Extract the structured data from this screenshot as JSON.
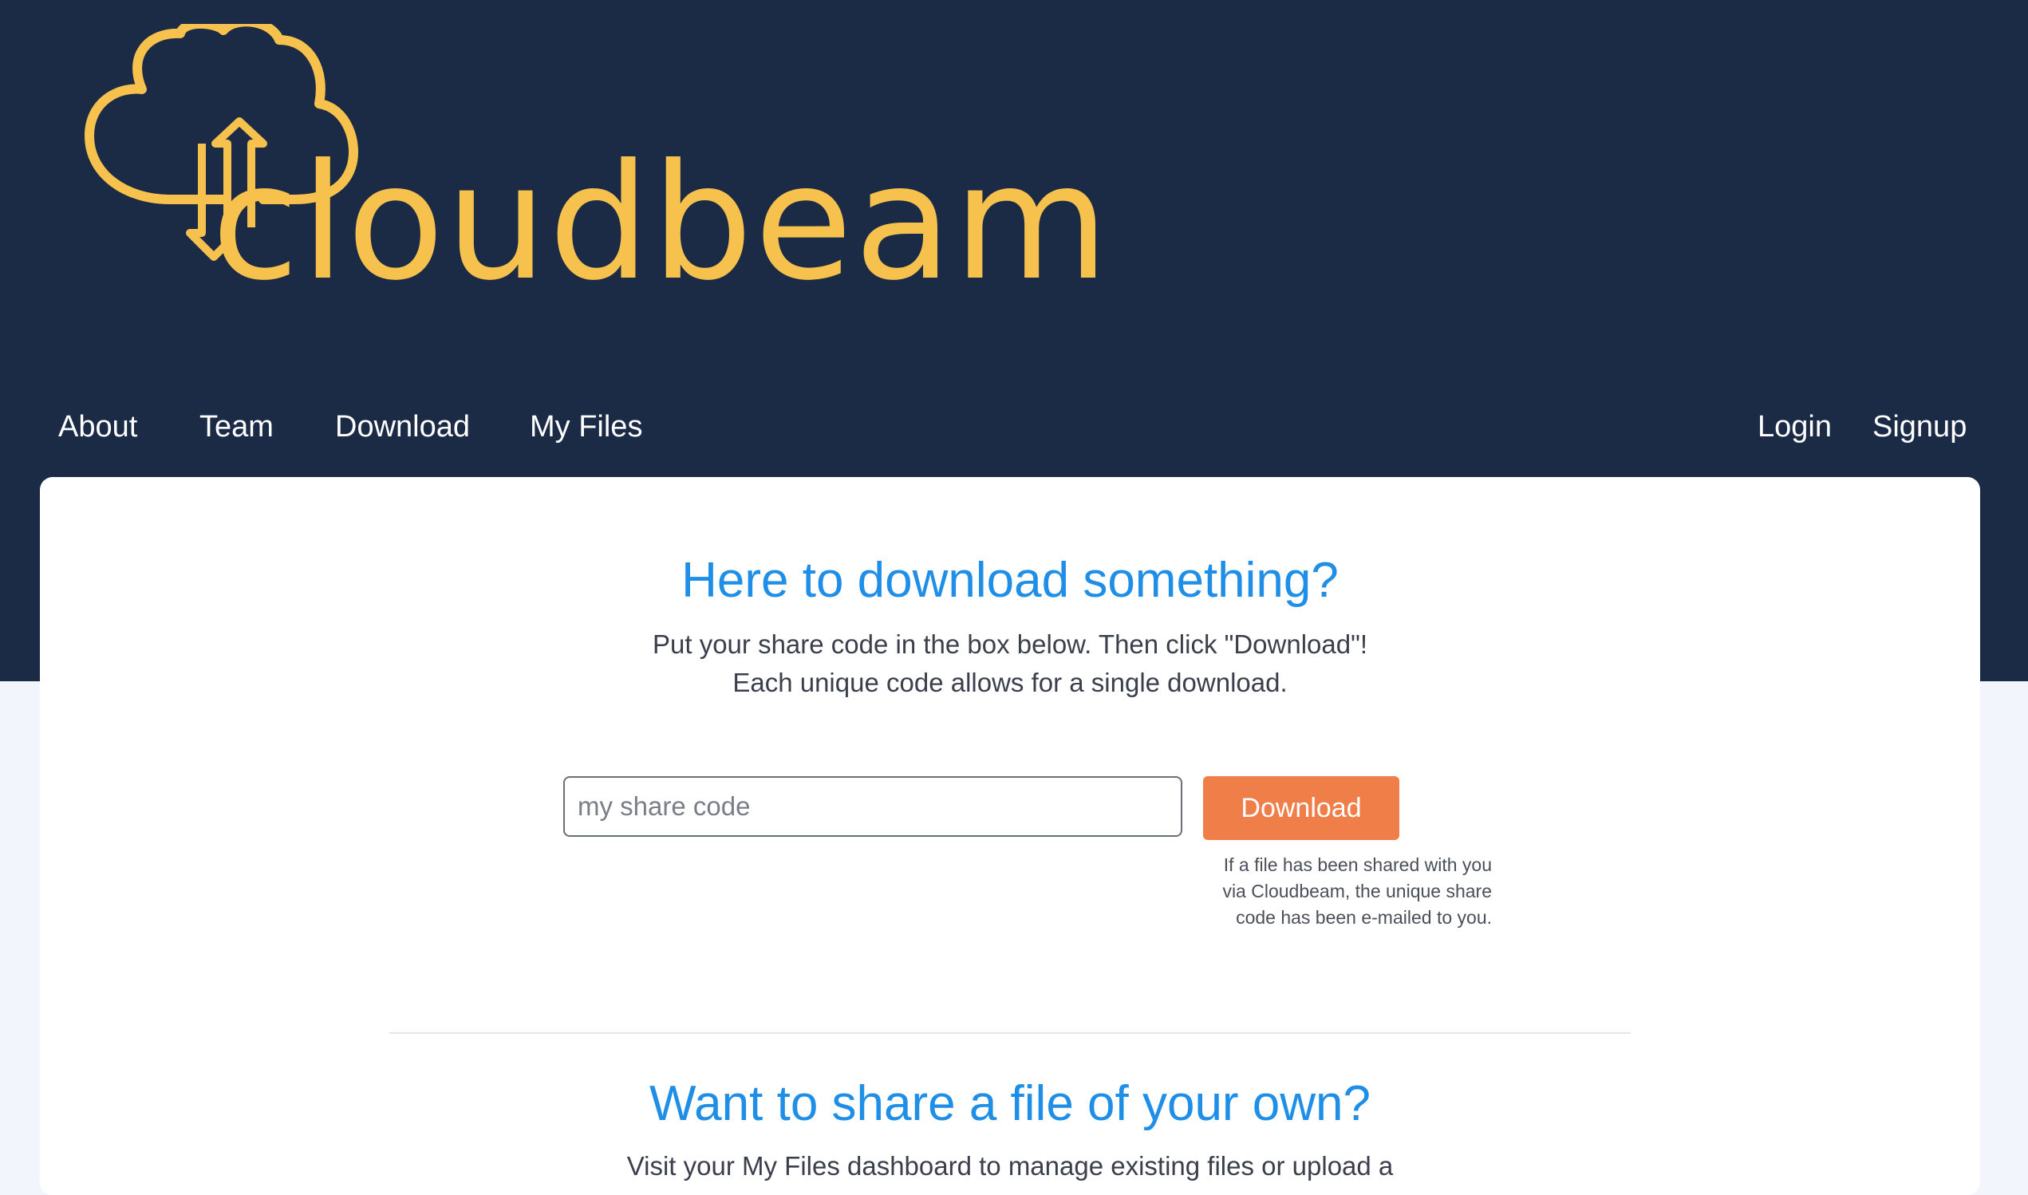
{
  "brand": {
    "name": "cloudbeam",
    "color": "#f6c14d"
  },
  "nav": {
    "left": [
      "About",
      "Team",
      "Download",
      "My Files"
    ],
    "right": [
      "Login",
      "Signup"
    ]
  },
  "download_section": {
    "title": "Here to download something?",
    "line1": "Put your share code in the box below. Then click \"Download\"!",
    "line2": "Each unique code allows for a single download.",
    "input_placeholder": "my share code",
    "input_value": "",
    "button_label": "Download",
    "hint_lines": [
      "If a file has been shared with you",
      "via Cloudbeam, the unique share",
      "code has been e-mailed to you."
    ]
  },
  "share_section": {
    "title": "Want to share a file of your own?",
    "line1": "Visit your My Files dashboard to manage existing files or upload a"
  },
  "colors": {
    "header_bg": "#1b2b46",
    "page_bg": "#f2f6fc",
    "accent_blue": "#1f8ee6",
    "button_orange": "#f07e48"
  },
  "icons": {
    "logo": "cloud-up-down-arrow-icon"
  }
}
